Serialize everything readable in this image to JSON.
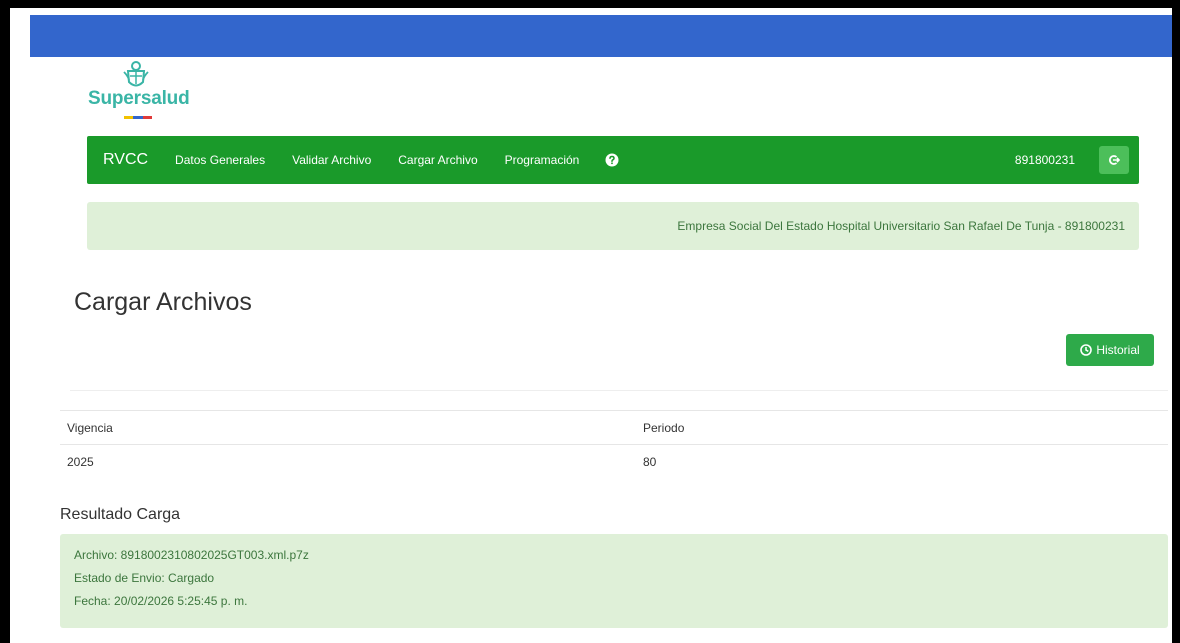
{
  "logo": {
    "brand": "Supersalud",
    "flag_colors": [
      "#f2c200",
      "#3366cc",
      "#e03a3a"
    ]
  },
  "navbar": {
    "brand": "RVCC",
    "items": [
      "Datos Generales",
      "Validar Archivo",
      "Cargar Archivo",
      "Programación"
    ],
    "user_id": "891800231",
    "color": "#1a9a2a"
  },
  "entity": {
    "text": "Empresa Social Del Estado Hospital Universitario San Rafael De Tunja - 891800231"
  },
  "page": {
    "title": "Cargar Archivos",
    "historial_label": "Historial"
  },
  "table": {
    "headers": [
      "Vigencia",
      "Periodo"
    ],
    "row": [
      "2025",
      "80"
    ]
  },
  "result": {
    "title": "Resultado Carga",
    "archivo": "Archivo: 8918002310802025GT003.xml.p7z",
    "estado": "Estado de Envio: Cargado",
    "fecha": "Fecha: 20/02/2026 5:25:45 p. m."
  },
  "icons": {
    "help": "question-circle-icon",
    "logout": "logout-icon",
    "historial": "clock-icon"
  }
}
